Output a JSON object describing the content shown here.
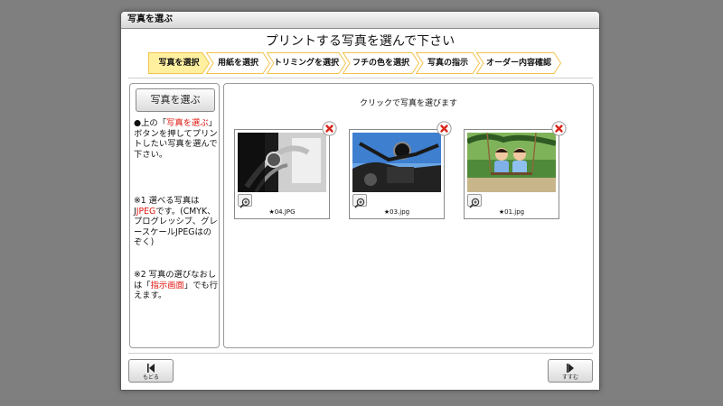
{
  "window": {
    "title": "写真を選ぶ"
  },
  "page_title": "プリントする写真を選んで下さい",
  "steps": [
    {
      "label": "写真を選択",
      "active": true
    },
    {
      "label": "用紙を選択",
      "active": false
    },
    {
      "label": "トリミングを選択",
      "active": false
    },
    {
      "label": "フチの色を選択",
      "active": false
    },
    {
      "label": "写真の指示",
      "active": false
    },
    {
      "label": "オーダー内容確認",
      "active": false
    }
  ],
  "left_panel": {
    "button_label": "写真を選ぶ",
    "note1": {
      "p1": "●上の「",
      "red": "写真を選ぶ",
      "p2": "」ボタンを押してプリントしたい写真を選んで下さい。"
    },
    "note2": {
      "p1": "※1 選べる写真はJ",
      "red": "JPEG",
      "p2": "です。(CMYK、プログレッシブ、グレースケールJPEGはのぞく)"
    },
    "note3": {
      "p1": "※2 写真の選びなおしは「",
      "red": "指示画面",
      "p2": "」でも行えます。"
    }
  },
  "main_panel": {
    "hint": "クリックで写真を選びます",
    "photos": [
      {
        "filename": "★04.JPG"
      },
      {
        "filename": "★03.jpg"
      },
      {
        "filename": "★01.jpg"
      }
    ]
  },
  "nav": {
    "back_label": "もどる",
    "next_label": "すすむ"
  },
  "colors": {
    "background": "#7f7f7f",
    "active_step": "#fff0a0",
    "step_border": "#f2c24a",
    "highlight_text": "#e0140e",
    "delete_red": "#d9261c"
  },
  "icons": {
    "zoom": "magnifier-plus-icon",
    "delete": "close-circle-icon",
    "back": "step-back-icon",
    "next": "step-forward-icon"
  }
}
